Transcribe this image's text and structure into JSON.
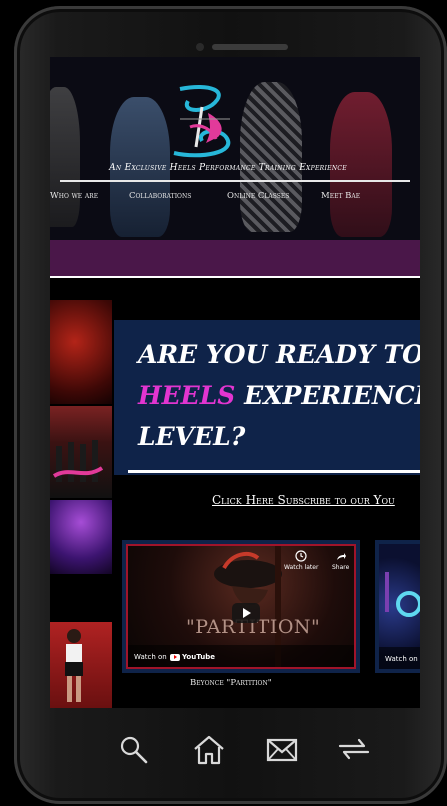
{
  "header": {
    "tagline": "An Exclusive Heels Performance Training Experience",
    "nav": [
      "Who we are",
      "Collaborations",
      "Online Classes",
      "Meet Bae"
    ]
  },
  "hero": {
    "line1": "ARE YOU READY TO",
    "line2_highlight": "HEELS",
    "line2_rest": " EXPERIENCE T",
    "line3": "LEVEL?",
    "highlight_color": "#e235d0"
  },
  "subscribe_link": "Click Here Subscribe to our You",
  "videos": [
    {
      "watch_label": "Watch on",
      "youtube_label": "YouTube",
      "watch_later": "Watch later",
      "share": "Share",
      "overlay_title": "\"PARTITION\"",
      "caption": "Beyonce  \"Partition\""
    },
    {
      "watch_label": "Watch on"
    }
  ],
  "bottom_bar": {
    "icons": [
      "search-icon",
      "home-icon",
      "mail-icon",
      "forward-arrow-icon"
    ]
  },
  "colors": {
    "accent": "#e235d0",
    "hero_bg": "#0f2349",
    "band": "#4a1749"
  }
}
